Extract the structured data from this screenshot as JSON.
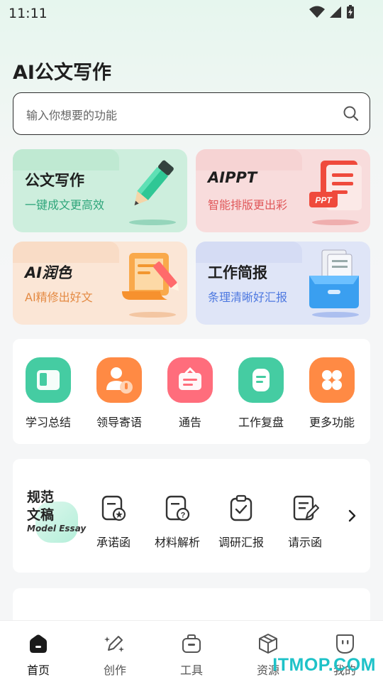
{
  "status_bar": {
    "time": "11:11"
  },
  "app": {
    "title": "AI公文写作"
  },
  "search": {
    "placeholder": "输入你想要的功能"
  },
  "feature_cards": [
    {
      "title": "公文写作",
      "subtitle": "一键成文更高效"
    },
    {
      "title": "AIPPT",
      "subtitle": "智能排版更出彩",
      "badge": "PPT"
    },
    {
      "title": "AI润色",
      "subtitle": "AI精修出好文"
    },
    {
      "title": "工作简报",
      "subtitle": "条理清晰好汇报"
    }
  ],
  "quick_actions": [
    {
      "label": "学习总结",
      "icon": "book-icon",
      "color": "#3fc9a1"
    },
    {
      "label": "领导寄语",
      "icon": "leader-mic-icon",
      "color": "#ff8a44"
    },
    {
      "label": "通告",
      "icon": "notice-icon",
      "color": "#ff6b7a"
    },
    {
      "label": "工作复盘",
      "icon": "review-doc-icon",
      "color": "#3fc9a1"
    },
    {
      "label": "更多功能",
      "icon": "grid-more-icon",
      "color": "#ff8a44"
    }
  ],
  "model_essay": {
    "title_line1": "规范",
    "title_line2": "文稿",
    "subtitle_en": "Model Essay",
    "items": [
      {
        "label": "承诺函",
        "icon": "promise-letter-icon"
      },
      {
        "label": "材料解析",
        "icon": "material-analysis-icon"
      },
      {
        "label": "调研汇报",
        "icon": "research-report-icon"
      },
      {
        "label": "请示函",
        "icon": "request-letter-icon"
      }
    ]
  },
  "bottom_nav": [
    {
      "label": "首页",
      "icon": "home-icon",
      "active": true
    },
    {
      "label": "创作",
      "icon": "create-pen-icon",
      "active": false
    },
    {
      "label": "工具",
      "icon": "toolbox-icon",
      "active": false
    },
    {
      "label": "资源",
      "icon": "cube-icon",
      "active": false
    },
    {
      "label": "我的",
      "icon": "profile-face-icon",
      "active": false
    }
  ],
  "watermark": "ITMOP.COM",
  "colors": {
    "accent_green": "#3fc9a1",
    "accent_orange": "#ff8a44",
    "accent_pink": "#ff6b7a",
    "watermark": "#1ec2c8"
  }
}
